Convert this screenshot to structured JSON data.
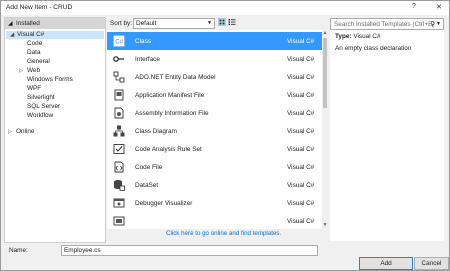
{
  "window": {
    "title": "Add New Item - CRUD",
    "help_label": "?",
    "close_label": "✕"
  },
  "left_panel": {
    "installed_label": "Installed",
    "tree": [
      {
        "label": "Visual C#",
        "arrow": "◢",
        "selected": true
      },
      {
        "label": "Code"
      },
      {
        "label": "Data"
      },
      {
        "label": "General"
      },
      {
        "label": "Web",
        "arrow": "▷"
      },
      {
        "label": "Windows Forms"
      },
      {
        "label": "WPF"
      },
      {
        "label": "Silverlight"
      },
      {
        "label": "SQL Server"
      },
      {
        "label": "Workflow"
      }
    ],
    "online_label": "Online",
    "online_arrow": "▷"
  },
  "toolbar": {
    "sort_by_label": "Sort by:",
    "sort_value": "Default"
  },
  "search": {
    "placeholder": "Search Installed Templates (Ctrl+E)",
    "icon": "search-icon"
  },
  "templates": [
    {
      "name": "Class",
      "lang": "Visual C#",
      "icon": "class-icon"
    },
    {
      "name": "Interface",
      "lang": "Visual C#",
      "icon": "interface-icon"
    },
    {
      "name": "ADO.NET Entity Data Model",
      "lang": "Visual C#",
      "icon": "entity-model-icon"
    },
    {
      "name": "Application Manifest File",
      "lang": "Visual C#",
      "icon": "manifest-icon"
    },
    {
      "name": "Assembly Information File",
      "lang": "Visual C#",
      "icon": "assembly-info-icon"
    },
    {
      "name": "Class Diagram",
      "lang": "Visual C#",
      "icon": "class-diagram-icon"
    },
    {
      "name": "Code Analysis Rule Set",
      "lang": "Visual C#",
      "icon": "rule-set-icon"
    },
    {
      "name": "Code File",
      "lang": "Visual C#",
      "icon": "code-file-icon"
    },
    {
      "name": "DataSet",
      "lang": "Visual C#",
      "icon": "dataset-icon"
    },
    {
      "name": "Debugger Visualizer",
      "lang": "Visual C#",
      "icon": "debugger-visualizer-icon"
    },
    {
      "name": "",
      "lang": "Visual C#",
      "icon": "partial-item-icon"
    }
  ],
  "online_link": "Click here to go online and find templates.",
  "info": {
    "type_label": "Type:",
    "type_value": "Visual C#",
    "description": "An empty class declaration"
  },
  "name_field": {
    "label": "Name:",
    "value": "Employee.cs"
  },
  "buttons": {
    "add": "Add",
    "cancel": "Cancel"
  },
  "colors": {
    "selection": "#3399ff",
    "link": "#0e70c0",
    "tree_selection": "#cce4f7"
  }
}
